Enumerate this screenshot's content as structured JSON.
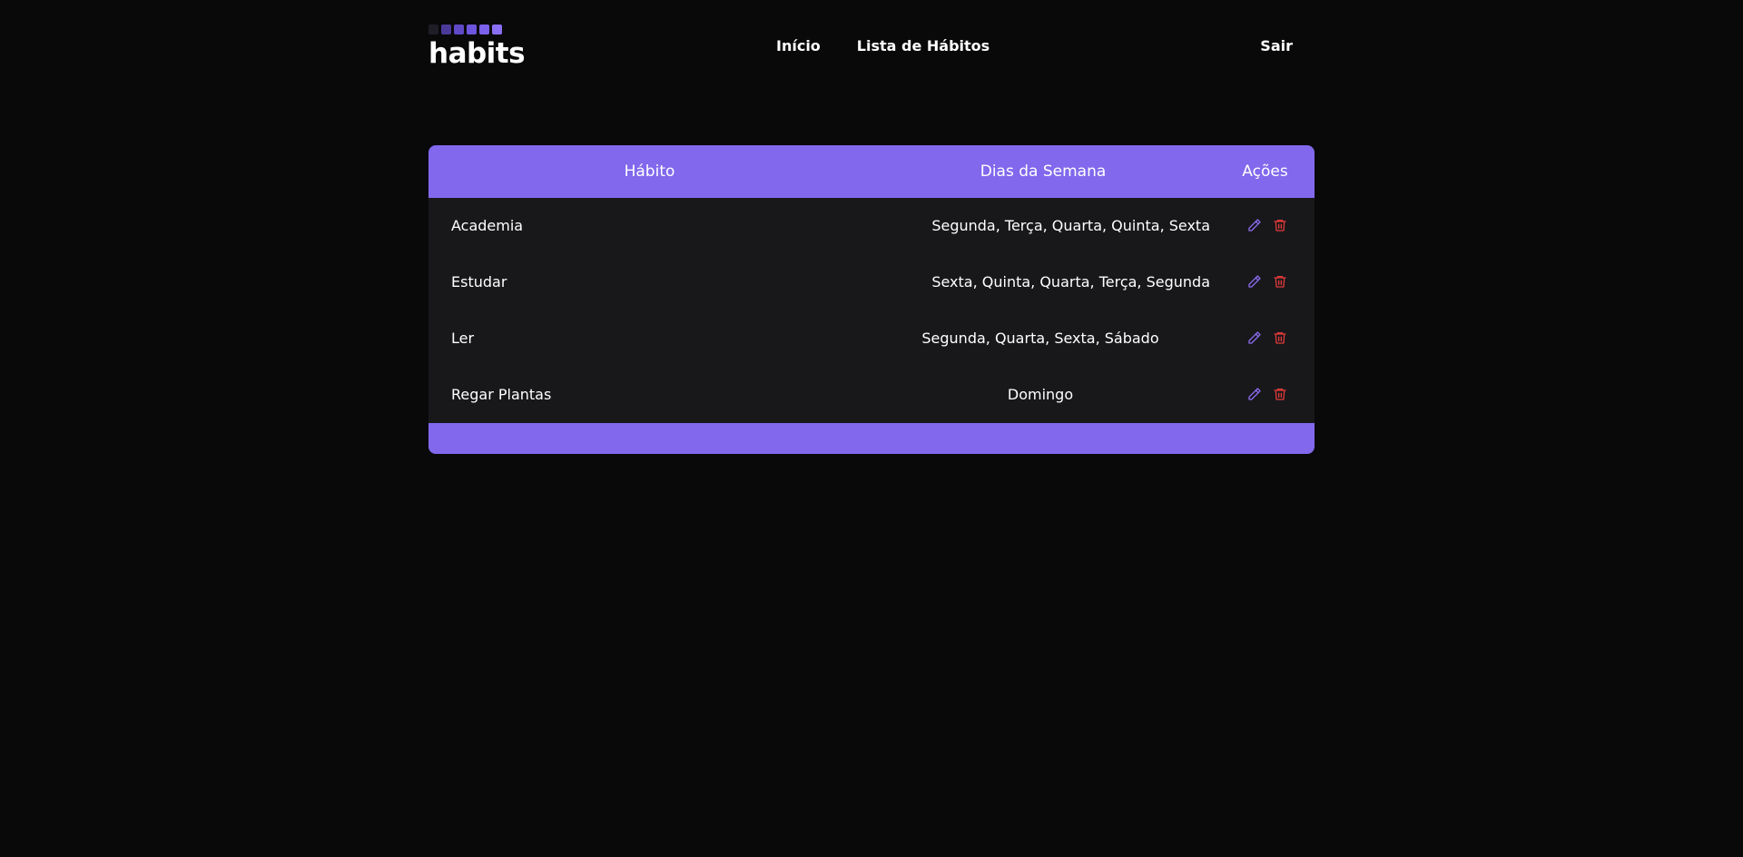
{
  "brand": {
    "name": "habits",
    "squares": [
      "#1f1d26",
      "#4c3a9a",
      "#6049c7",
      "#6e55de",
      "#7b61eb",
      "#8a6ff5"
    ]
  },
  "nav": {
    "items": [
      {
        "label": "Início"
      },
      {
        "label": "Lista de Hábitos"
      }
    ],
    "logout_label": "Sair"
  },
  "table": {
    "headers": {
      "habit": "Hábito",
      "days": "Dias da Semana",
      "actions": "Ações"
    },
    "rows": [
      {
        "habit": "Academia",
        "days": "Segunda, Terça, Quarta, Quinta, Sexta"
      },
      {
        "habit": "Estudar",
        "days": "Sexta, Quinta, Quarta, Terça, Segunda"
      },
      {
        "habit": "Ler",
        "days": "Segunda, Quarta, Sexta, Sábado"
      },
      {
        "habit": "Regar Plantas",
        "days": "Domingo"
      }
    ],
    "icons": {
      "edit": "pencil-icon",
      "delete": "trash-icon"
    }
  },
  "colors": {
    "background": "#09090a",
    "accent": "#8168ec",
    "row_bg": "#18181b",
    "edit_icon": "#8b6cf0",
    "delete_icon": "#e03a3a"
  }
}
